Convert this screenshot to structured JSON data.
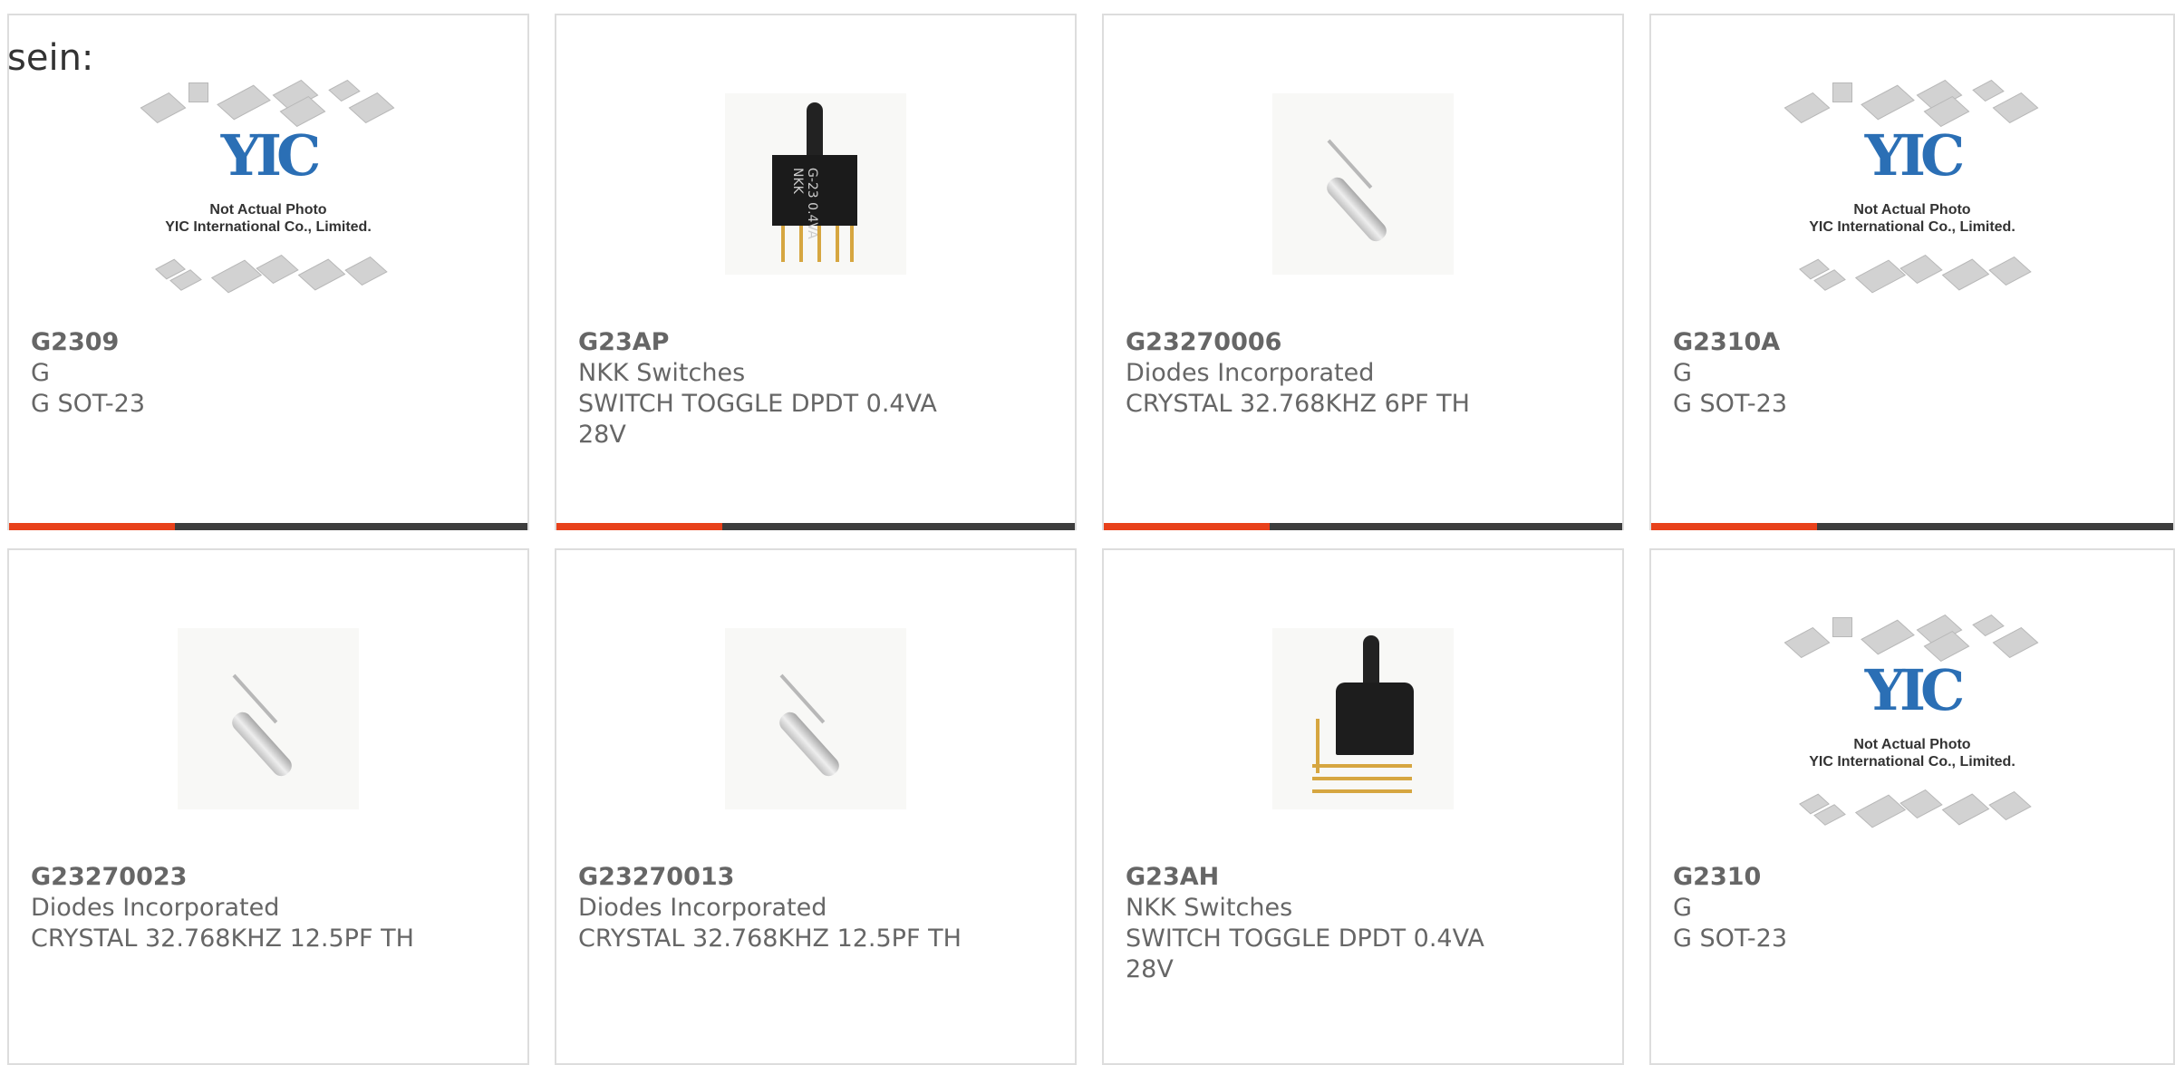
{
  "heading": "sein:",
  "placeholder": {
    "logo": "YIC",
    "line1": "Not Actual Photo",
    "line2": "YIC International Co., Limited."
  },
  "colors": {
    "accent": "#e8411b",
    "bar": "#3d3d3d",
    "text": "#666666",
    "border": "#dddddd"
  },
  "cards": [
    {
      "part": "G2309",
      "maker": "G",
      "desc": "G SOT-23",
      "image": "placeholder"
    },
    {
      "part": "G23AP",
      "maker": "NKK Switches",
      "desc": "SWITCH TOGGLE DPDT 0.4VA 28V",
      "image": "toggle-switch"
    },
    {
      "part": "G23270006",
      "maker": "Diodes Incorporated",
      "desc": "CRYSTAL 32.768KHZ 6PF TH",
      "image": "crystal"
    },
    {
      "part": "G2310A",
      "maker": "G",
      "desc": "G SOT-23",
      "image": "placeholder"
    },
    {
      "part": "G23270023",
      "maker": "Diodes Incorporated",
      "desc": "CRYSTAL 32.768KHZ 12.5PF TH",
      "image": "crystal"
    },
    {
      "part": "G23270013",
      "maker": "Diodes Incorporated",
      "desc": "CRYSTAL 32.768KHZ 12.5PF TH",
      "image": "crystal"
    },
    {
      "part": "G23AH",
      "maker": "NKK Switches",
      "desc": "SWITCH TOGGLE DPDT 0.4VA 28V",
      "image": "toggle-switch-right-angle"
    },
    {
      "part": "G2310",
      "maker": "G",
      "desc": "G SOT-23",
      "image": "placeholder"
    }
  ]
}
